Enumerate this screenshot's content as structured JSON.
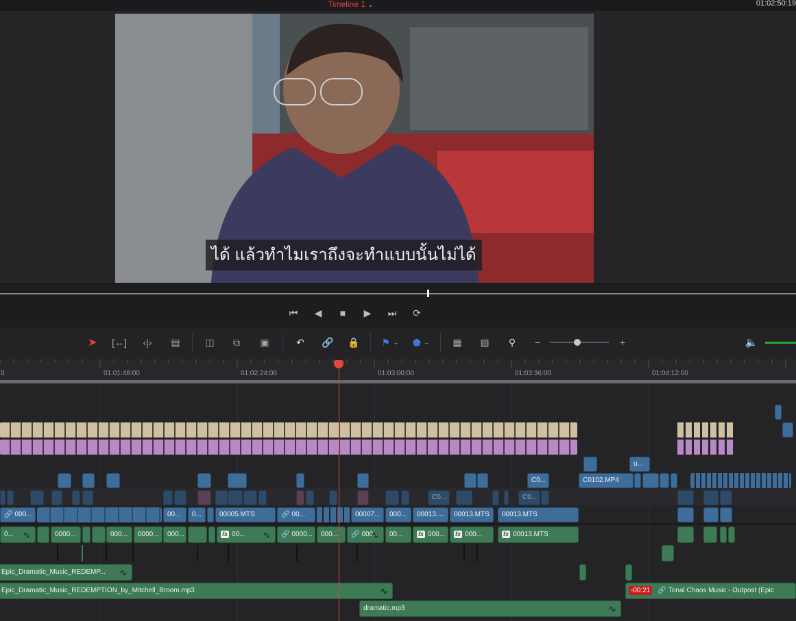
{
  "header": {
    "timeline_title": "Timeline 1",
    "timecode": "01:02:50:19"
  },
  "viewer": {
    "subtitle_text": "ได้ แล้วทำไมเราถึงจะทำแบบนั้นไม่ได้"
  },
  "ruler": {
    "ticks": [
      "0",
      "01:01:48:00",
      "01:02:24:00",
      "01:03:00:00",
      "01:03:36:00",
      "01:04:12:00"
    ]
  },
  "clips": {
    "v_c0_a": "C0...",
    "v_c0102": "C0102.MP4",
    "v_u": "u...",
    "v_c0_b": "C0...",
    "v_c0_c": "C0...",
    "v1_a": "000...",
    "v1_b": "00...",
    "v1_c": "000...",
    "v1_d": "0...",
    "v1_e": "00005.MTS",
    "v1_f": "00...",
    "v1_g": "00007...",
    "v1_h": "000...",
    "v1_i": "00013....",
    "v1_j": "00013.MTS",
    "v1_k": "00013.MTS",
    "a1_a": "0...",
    "a1_b": "0000...",
    "a1_c": "000...",
    "a1_d": "0000...",
    "a1_e": "000...",
    "a1_f": "00...",
    "a1_g": "0000...",
    "a1_h": "000...",
    "a1_i": "000...",
    "a1_j": "00...",
    "a1_k": "000...",
    "a1_l": "00013.MTS",
    "music1": "Epic_Dramatic_Music_REDEMP...",
    "music2": "Epic_Dramatic_Music_REDEMPTION_by_Mitchell_Broom.mp3",
    "music3_offset": "-00:21",
    "music3": "Tonal Chaos Music - Outpost (Epic",
    "music4": "dramatic.mp3"
  },
  "colors": {
    "accent": "#e1453c",
    "video_clip": "#3f6d9a",
    "audio_clip": "#3d7a55",
    "subtitle_track_1": "#cfc0a2",
    "subtitle_track_2": "#b889c4"
  }
}
